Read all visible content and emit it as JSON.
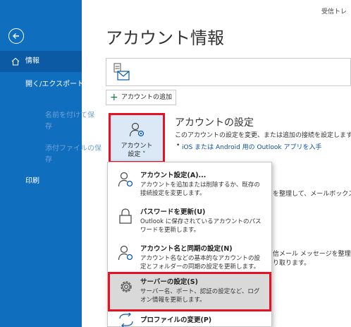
{
  "topbar": {
    "title": "受信トレ"
  },
  "sidebar": {
    "items": [
      {
        "label": "情報",
        "state": "active"
      },
      {
        "label": "開く/エクスポート",
        "state": "normal"
      },
      {
        "label": "名前を付けて保",
        "label2": "存",
        "state": "disabled"
      },
      {
        "label": "添付ファイルの保",
        "label2": "存",
        "state": "disabled"
      },
      {
        "label": "印刷",
        "state": "normal"
      }
    ]
  },
  "page": {
    "title": "アカウント情報"
  },
  "add_account": {
    "label": "アカウントの追加"
  },
  "account_settings_tile": {
    "label_line1": "アカウント",
    "label_line2": "設定 ˅"
  },
  "section": {
    "title": "アカウントの設定",
    "description": "このアカウントの設定を変更、または追加の接続を設定します。",
    "link": "iOS または Android 用の Outlook アプリを入手"
  },
  "background_fragments": {
    "frag1": "を整理して、メールボックスの",
    "frag2": "信メール メッセージを整理し",
    "frag3": "り取ります。"
  },
  "menu": {
    "items": [
      {
        "title": "アカウント設定(A)...",
        "desc1": "アカウントを追加または削除するか、既存の",
        "desc2": "接続設定を変更します。"
      },
      {
        "title": "パスワードを更新(U)",
        "desc1": "Outlook に保存されているアカウントのパス",
        "desc2": "ワードを更新します。"
      },
      {
        "title": "アカウント名と同期の設定(N)",
        "desc1": "アカウント名などの基本的なアカウントの設",
        "desc2": "定とフォルダーの同期の設定を更新します。"
      },
      {
        "title": "サーバーの設定(S)",
        "desc1": "サーバー名、ポート、認証の設定など、ログ",
        "desc2": "オン情報を更新します。"
      },
      {
        "title": "プロファイルの変更(P)",
        "desc1": "",
        "desc2": ""
      }
    ]
  },
  "colors": {
    "sidebar": "#106ebe",
    "sidebar_active": "#0b5aa3",
    "highlight_border": "#e81123",
    "link": "#0b4fa0"
  }
}
